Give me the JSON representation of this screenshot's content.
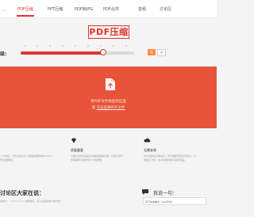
{
  "header": {
    "logo_sub": "com",
    "nav": [
      "PDF压缩",
      "PPT压缩",
      "PDF转JPG",
      "PDF合并",
      "音频",
      "讨论区"
    ]
  },
  "main": {
    "title": "PDF压缩",
    "level_label": "级:",
    "slider": {
      "value_fraction": 0.71
    },
    "ticks": [
      "1",
      "2",
      "3",
      "4",
      "5",
      "6",
      "7",
      "8",
      "9"
    ],
    "badges": [
      "低",
      "中"
    ]
  },
  "upload": {
    "line1": "将PDF文件拖放到这里",
    "line2_prefix": "或",
    "line2_link": "点击选择PDF文件"
  },
  "features": [
    {
      "title": "",
      "desc": "一小时后，文件将会永久从网站的服务器中100%安全地删除。"
    },
    {
      "title": "质量重要",
      "desc": "大部分文件压缩后对清晰度保持不错，可通过调节压缩级别平衡文件大小和质量。"
    },
    {
      "title": "无需安装",
      "desc": "PDF压缩在云端运行，用不需要安装任何软件，不用担心卡顿，在浏览器中即可完成压缩。"
    }
  ],
  "reviews": {
    "title": "讨论区大家在说：",
    "row_user": "某用户：",
    "row_time": "2021/09/11",
    "row_text": "功能很好，可以压缩非常大的文件"
  },
  "quote": {
    "title": "我说一句：",
    "placeholder": "写下你的看法（200字内）"
  },
  "colors": {
    "accent": "#e0362b",
    "upload_bg": "#e8543a"
  }
}
